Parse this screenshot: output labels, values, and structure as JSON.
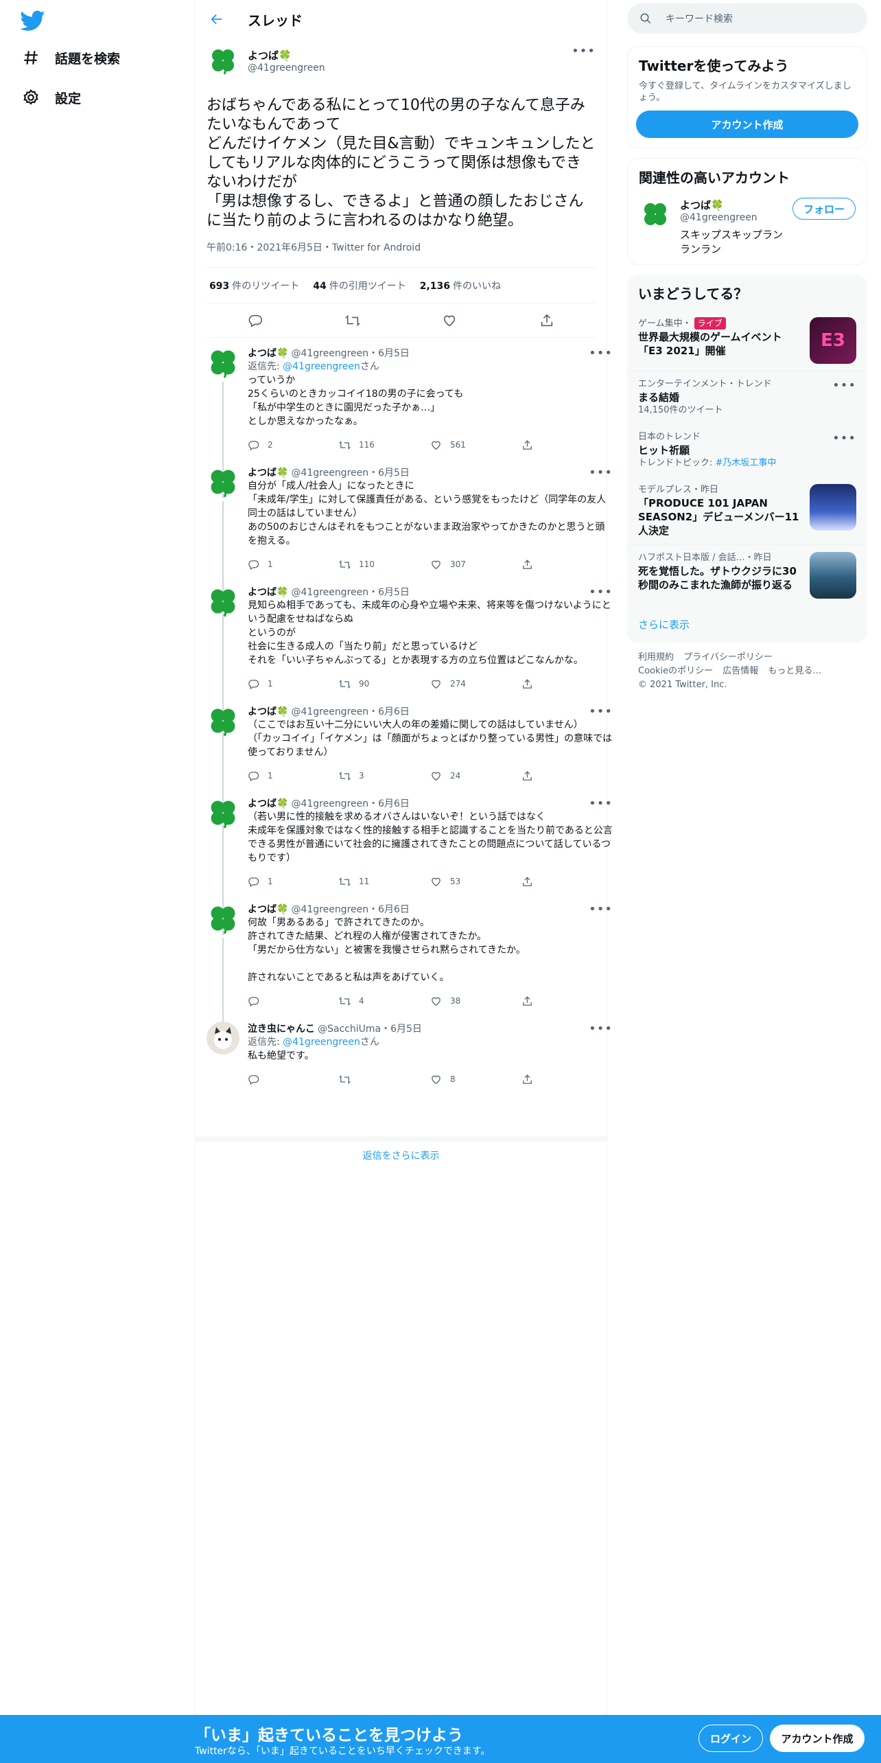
{
  "nav": {
    "explore_label": "話題を検索",
    "settings_label": "設定"
  },
  "header": {
    "title": "スレッド"
  },
  "main_tweet": {
    "name": "よつば🍀",
    "handle": "@41greengreen",
    "text": "おばちゃんである私にとって10代の男の子なんて息子みたいなもんであって\nどんだけイケメン（見た目&言動）でキュンキュンしたとしてもリアルな肉体的にどうこうって関係は想像もできないわけだが\n「男は想像するし、できるよ」と普通の顔したおじさんに当たり前のように言われるのはかなり絶望。",
    "meta": "午前0:16・2021年6月5日・Twitter for Android",
    "stats": {
      "retweets_count": "693",
      "retweets_label": "件のリツイート",
      "quotes_count": "44",
      "quotes_label": "件の引用ツイート",
      "likes_count": "2,136",
      "likes_label": "件のいいね"
    }
  },
  "replies": [
    {
      "name": "よつば🍀",
      "handle": "@41greengreen・6月5日",
      "replyto_prefix": "返信先: ",
      "replyto_handle": "@41greengreen",
      "replyto_suffix": "さん",
      "text": "っていうか\n25くらいのときカッコイイ18の男の子に会っても\n「私が中学生のときに園児だった子かぁ…」\nとしか思えなかったなぁ。",
      "replies": "2",
      "retweets": "116",
      "likes": "561"
    },
    {
      "name": "よつば🍀",
      "handle": "@41greengreen・6月5日",
      "text": "自分が「成人/社会人」になったときに\n「未成年/学生」に対して保護責任がある、という感覚をもったけど（同学年の友人同士の話はしていません）\nあの50のおじさんはそれをもつことがないまま政治家やってかきたのかと思うと頭を抱える。",
      "replies": "1",
      "retweets": "110",
      "likes": "307"
    },
    {
      "name": "よつば🍀",
      "handle": "@41greengreen・6月5日",
      "text": "見知らぬ相手であっても、未成年の心身や立場や未来、将来等を傷つけないようにという配慮をせねばならぬ\nというのが\n社会に生きる成人の「当たり前」だと思っているけど\nそれを「いい子ちゃんぶってる」とか表現する方の立ち位置はどこなんかな。",
      "replies": "1",
      "retweets": "90",
      "likes": "274"
    },
    {
      "name": "よつば🍀",
      "handle": "@41greengreen・6月6日",
      "text": "（ここではお互い十二分にいい大人の年の差婚に関しての話はしていません）\n（「カッコイイ」「イケメン」は「顔面がちょっとばかり整っている男性」の意味では使っておりません）",
      "replies": "1",
      "retweets": "3",
      "likes": "24"
    },
    {
      "name": "よつば🍀",
      "handle": "@41greengreen・6月6日",
      "text": "（若い男に性的接触を求めるオバさんはいないぞ！という話ではなく\n未成年を保護対象ではなく性的接触する相手と認識することを当たり前であると公言できる男性が普通にいて社会的に擁護されてきたことの問題点について話しているつもりです）",
      "replies": "1",
      "retweets": "11",
      "likes": "53"
    },
    {
      "name": "よつば🍀",
      "handle": "@41greengreen・6月6日",
      "text": "何故「男あるある」で許されてきたのか。\n許されてきた結果、どれ程の人権が侵害されてきたか。\n「男だから仕方ない」と被害を我慢させられ黙らされてきたか。\n\n許されないことであると私は声をあげていく。",
      "replies": "",
      "retweets": "4",
      "likes": "38"
    },
    {
      "name": "泣き虫にゃんこ",
      "handle": "@SacchiUma・6月5日",
      "replyto_prefix": "返信先: ",
      "replyto_handle": "@41greengreen",
      "replyto_suffix": "さん",
      "text": "私も絶望です。",
      "replies": "",
      "retweets": "",
      "likes": "8"
    }
  ],
  "more_replies_label": "返信をさらに表示",
  "search": {
    "placeholder": "キーワード検索"
  },
  "join_card": {
    "title": "Twitterを使ってみよう",
    "subtitle": "今すぐ登録して、タイムラインをカスタマイズしましょう。",
    "button": "アカウント作成"
  },
  "related_card": {
    "title": "関連性の高いアカウント",
    "name": "よつば🍀",
    "handle": "@41greengreen",
    "bio": "スキップスキップランランラン",
    "follow_label": "フォロー"
  },
  "trends_card": {
    "title": "いまどうしてる？",
    "items": [
      {
        "meta": "ゲーム集中・",
        "live": "ライブ",
        "title": "世界最大規模のゲームイベント「E3 2021」開催",
        "sub": ""
      },
      {
        "meta": "エンターテインメント・トレンド",
        "title": "まる結婚",
        "sub": "14,150件のツイート"
      },
      {
        "meta": "日本のトレンド",
        "title": "ヒット祈願",
        "sub_prefix": "トレンドトピック: ",
        "sub_link": "#乃木坂工事中"
      },
      {
        "meta": "モデルプレス・昨日",
        "title": "「PRODUCE 101 JAPAN SEASON2」デビューメンバー11人決定"
      },
      {
        "meta": "ハフポスト日本版 / 会話…・昨日",
        "title": "死を覚悟した。ザトウクジラに30秒間のみこまれた漁師が振り返る"
      }
    ],
    "show_more": "さらに表示"
  },
  "footer": {
    "links": [
      "利用規約",
      "プライバシーポリシー",
      "Cookieのポリシー",
      "広告情報",
      "もっと見る…"
    ],
    "copyright": "© 2021 Twitter, Inc."
  },
  "bottom_bar": {
    "title": "「いま」起きていることを見つけよう",
    "subtitle": "Twitterなら、「いま」起きていることをいち早くチェックできます。",
    "login": "ログイン",
    "signup": "アカウント作成"
  },
  "colors": {
    "accent": "#1d9bf0",
    "clover": "#1fa33a"
  }
}
